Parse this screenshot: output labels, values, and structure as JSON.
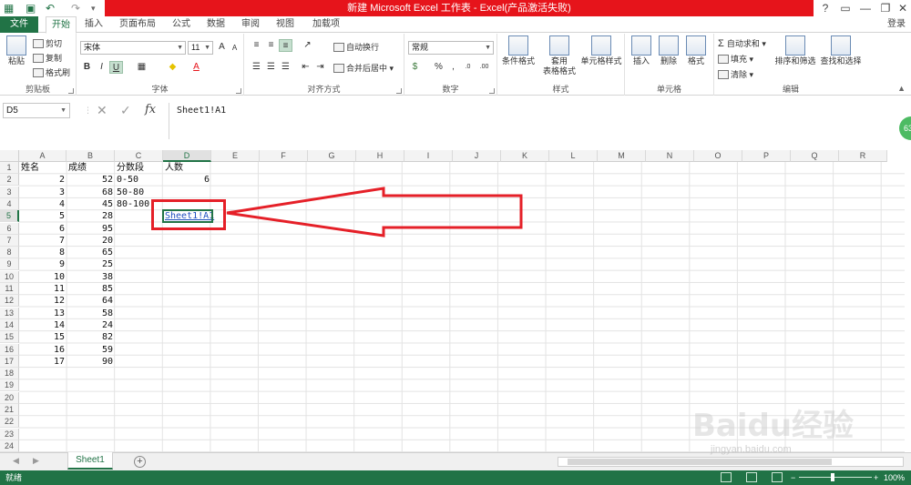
{
  "window": {
    "title": "新建 Microsoft Excel 工作表 - Excel(产品激活失败)",
    "controls": [
      "?",
      "▭",
      "—",
      "❐",
      "✕"
    ]
  },
  "ribbon_tabs": {
    "file": "文件",
    "tabs": [
      "开始",
      "插入",
      "页面布局",
      "公式",
      "数据",
      "审阅",
      "视图",
      "加载项"
    ],
    "signin": "登录"
  },
  "clipboard": {
    "paste": "粘贴",
    "cut": "剪切",
    "copy": "复制",
    "painter": "格式刷",
    "label": "剪贴板"
  },
  "font": {
    "name": "宋体",
    "size": "11",
    "label": "字体",
    "bold": "B",
    "italic": "I",
    "underline": "U"
  },
  "alignment": {
    "wrap": "自动换行",
    "merge": "合并后居中",
    "label": "对齐方式"
  },
  "number": {
    "format": "常规",
    "label": "数字"
  },
  "styles": {
    "conditional": "条件格式",
    "table1": "套用",
    "table2": "表格格式",
    "cell": "单元格样式",
    "label": "样式"
  },
  "cells_group": {
    "insert": "插入",
    "delete": "删除",
    "format": "格式",
    "label": "单元格"
  },
  "editing": {
    "autosum": "自动求和",
    "fill": "填充",
    "clear": "清除",
    "sort": "排序和筛选",
    "find": "查找和选择",
    "label": "编辑"
  },
  "formula_bar": {
    "name_box": "D5",
    "fx": "fx",
    "content": "Sheet1!A1"
  },
  "columns": [
    "A",
    "B",
    "C",
    "D",
    "E",
    "F",
    "G",
    "H",
    "I",
    "J",
    "K",
    "L",
    "M",
    "N",
    "O",
    "P",
    "Q",
    "R"
  ],
  "rows": [
    "1",
    "2",
    "3",
    "4",
    "5",
    "6",
    "7",
    "8",
    "9",
    "10",
    "11",
    "12",
    "13",
    "14",
    "15",
    "16",
    "17",
    "18",
    "19",
    "20",
    "21",
    "22",
    "23",
    "24"
  ],
  "sheet": {
    "header": {
      "A": "姓名",
      "B": "成绩",
      "C": "分数段",
      "D": "人数"
    },
    "col_a": [
      "2",
      "3",
      "4",
      "5",
      "6",
      "7",
      "8",
      "9",
      "10",
      "11",
      "12",
      "13",
      "14",
      "15",
      "16",
      "17"
    ],
    "col_b": [
      "52",
      "68",
      "45",
      "28",
      "95",
      "20",
      "65",
      "25",
      "38",
      "85",
      "64",
      "58",
      "24",
      "82",
      "59",
      "90"
    ],
    "col_c": [
      "0-50",
      "50-80",
      "80-100"
    ],
    "d2": "6",
    "d5": "Sheet1!A1"
  },
  "selected": {
    "column": "D",
    "row": "5"
  },
  "sheet_tabs": {
    "active": "Sheet1",
    "add": "+"
  },
  "status": {
    "ready": "就绪",
    "zoom": "100%"
  },
  "watermark": {
    "brand": "Baidu经验",
    "url": "jingyan.baidu.com"
  },
  "badge": "63",
  "colors": {
    "excel_green": "#217346",
    "title_red": "#e6141b",
    "annotation_red": "#e52028",
    "link_blue": "#1f4fbf"
  }
}
